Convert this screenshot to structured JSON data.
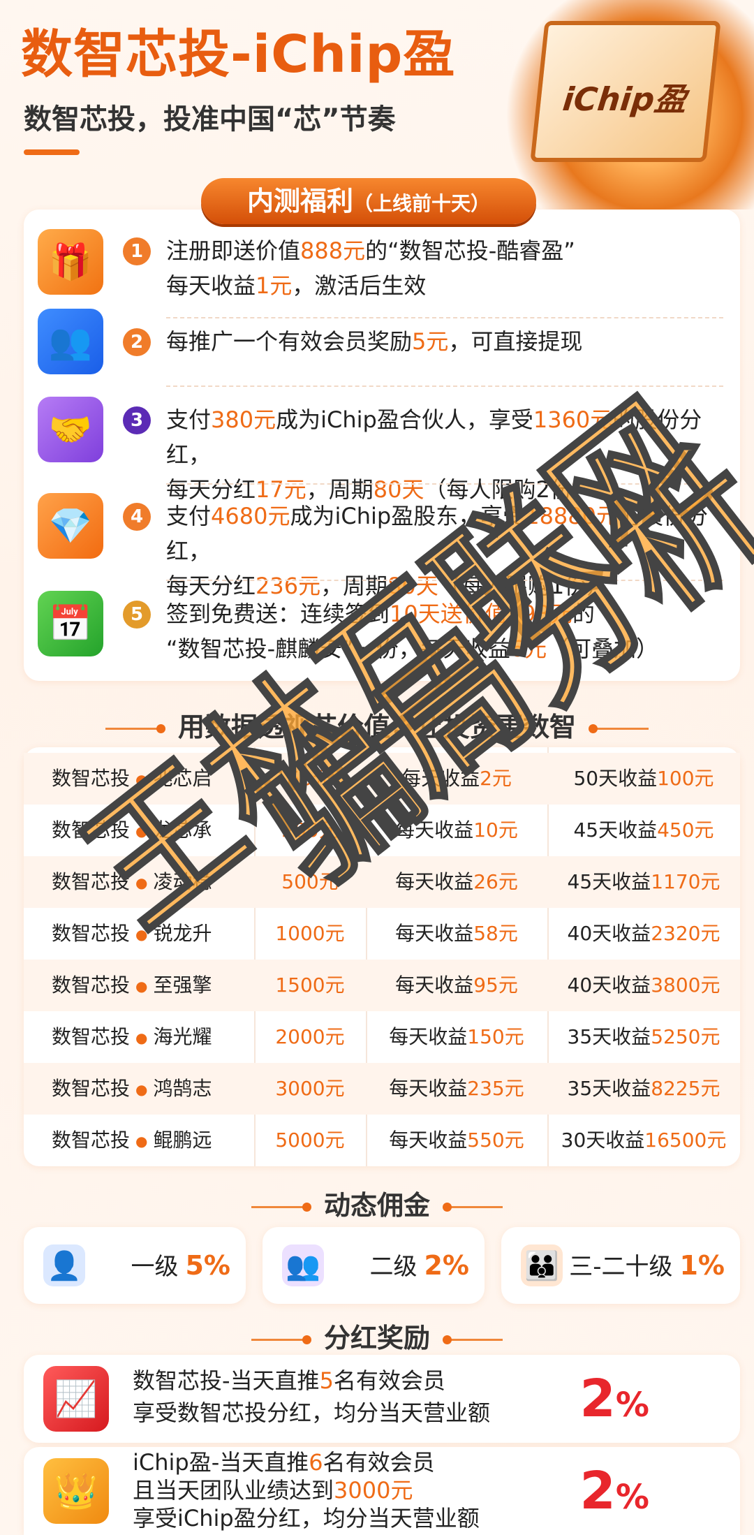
{
  "header": {
    "title": "数智芯投-iChip盈",
    "subtitle": "数智芯投，投准中国“芯”节奏",
    "chip_label": "iChip盈"
  },
  "ribbon": {
    "main": "内测福利",
    "sub": "（上线前十天）"
  },
  "perks": [
    {
      "num": "1",
      "icon": "gift-icon",
      "line1_a": "注册即送价值",
      "line1_b": "888元",
      "line1_c": "的“数智芯投-酷睿盈”",
      "line2_a": "每天收益",
      "line2_b": "1元",
      "line2_c": "，激活后生效"
    },
    {
      "num": "2",
      "icon": "users-icon",
      "line1_a": "每推广一个有效会员奖励",
      "line1_b": "5元",
      "line1_c": "，可直接提现"
    },
    {
      "num": "3",
      "icon": "partner-icon",
      "line1_a": "支付",
      "line1_b": "380元",
      "line1_c": "成为iChip盈合伙人，享受",
      "line1_d": "1360元",
      "line1_e": "的股份分红，",
      "line2_a": "每天分红",
      "line2_b": "17元",
      "line2_c": "，周期",
      "line2_d": "80天",
      "line2_e": "（每人限购2份）"
    },
    {
      "num": "4",
      "icon": "diamond-icon",
      "line1_a": "支付",
      "line1_b": "4680元",
      "line1_c": "成为iChip盈股东，享受",
      "line1_d": "18880元",
      "line1_e": "的股份分红，",
      "line2_a": "每天分红",
      "line2_b": "236元",
      "line2_c": "，周期",
      "line2_d": "80天",
      "line2_e": "（每人限购1份）"
    },
    {
      "num": "5",
      "icon": "calendar-check-icon",
      "line1_a": "签到免费送：连续签到",
      "line1_b": "10天送价值198元",
      "line1_c": "的",
      "line2_a": "“数智芯投-麒麟安”一份，每天收益",
      "line2_b": "6元",
      "line2_c": "（可叠加）"
    }
  ],
  "section_table": "用数据透视芯价值，让投资更数智",
  "products": [
    {
      "series": "数智芯投",
      "name": "兆芯启",
      "price": "50元",
      "daily_a": "每天收益",
      "daily_b": "2元",
      "total_a": "50天收益",
      "total_b": "100元"
    },
    {
      "series": "数智芯投",
      "name": "龙芯承",
      "price": "200元",
      "daily_a": "每天收益",
      "daily_b": "10元",
      "total_a": "45天收益",
      "total_b": "450元"
    },
    {
      "series": "数智芯投",
      "name": "凌动稳",
      "price": "500元",
      "daily_a": "每天收益",
      "daily_b": "26元",
      "total_a": "45天收益",
      "total_b": "1170元"
    },
    {
      "series": "数智芯投",
      "name": "锐龙升",
      "price": "1000元",
      "daily_a": "每天收益",
      "daily_b": "58元",
      "total_a": "40天收益",
      "total_b": "2320元"
    },
    {
      "series": "数智芯投",
      "name": "至强擎",
      "price": "1500元",
      "daily_a": "每天收益",
      "daily_b": "95元",
      "total_a": "40天收益",
      "total_b": "3800元"
    },
    {
      "series": "数智芯投",
      "name": "海光耀",
      "price": "2000元",
      "daily_a": "每天收益",
      "daily_b": "150元",
      "total_a": "35天收益",
      "total_b": "5250元"
    },
    {
      "series": "数智芯投",
      "name": "鸿鹄志",
      "price": "3000元",
      "daily_a": "每天收益",
      "daily_b": "235元",
      "total_a": "35天收益",
      "total_b": "8225元"
    },
    {
      "series": "数智芯投",
      "name": "鲲鹏远",
      "price": "5000元",
      "daily_a": "每天收益",
      "daily_b": "550元",
      "total_a": "30天收益",
      "total_b": "16500元"
    }
  ],
  "section_commission": "动态佣金",
  "commission": [
    {
      "level": "一级",
      "pct": "5%",
      "icon": "user-icon"
    },
    {
      "level": "二级",
      "pct": "2%",
      "icon": "users-icon"
    },
    {
      "level": "三-二十级",
      "pct": "1%",
      "icon": "group-icon"
    }
  ],
  "section_dividend": "分红奖励",
  "dividends": [
    {
      "icon": "growth-chart-icon",
      "l1_a": "数智芯投-当天直推",
      "l1_b": "5",
      "l1_c": "名有效会员",
      "l2": "享受数智芯投分红，均分当天营业额",
      "pct": "2",
      "pct_sign": "%"
    },
    {
      "icon": "crown-icon",
      "l1_a": "iChip盈-当天直推",
      "l1_b": "6",
      "l1_c": "名有效会员",
      "l2_a": "且当天团队业绩达到",
      "l2_b": "3000元",
      "l3": "享受iChip盈分红，均分当天营业额",
      "pct": "2",
      "pct_sign": "%"
    }
  ],
  "watermark": {
    "line1": "王林互联网",
    "line2": "骗局分析"
  },
  "colors": {
    "accent": "#ef6b16",
    "red": "#e8262c",
    "bg": "#fff7f0"
  }
}
